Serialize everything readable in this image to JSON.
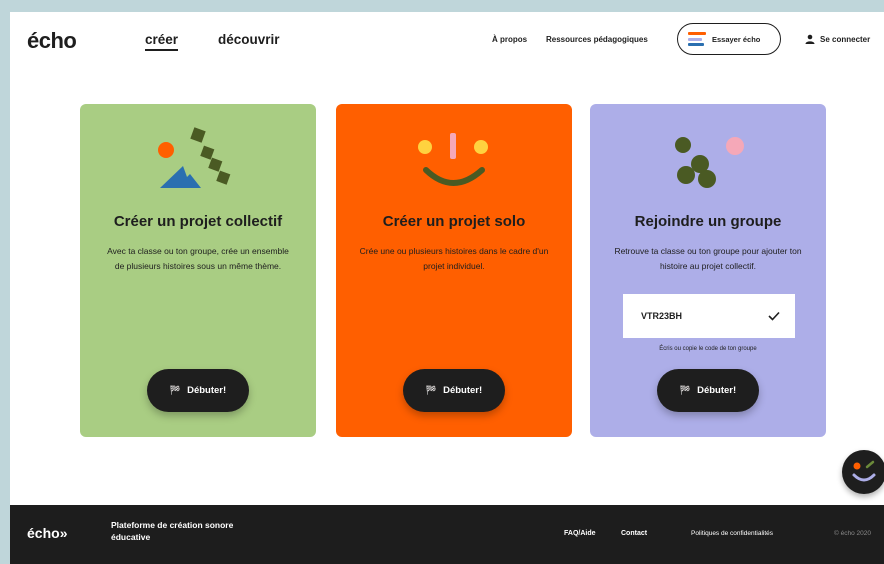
{
  "header": {
    "logo": "écho",
    "nav": {
      "creer": "créer",
      "decouvrir": "découvrir"
    },
    "links": {
      "apropos": "À propos",
      "ressources": "Ressources pédagogiques"
    },
    "try_button": "Essayer écho",
    "login": "Se connecter"
  },
  "cards": {
    "collective": {
      "title": "Créer un projet collectif",
      "description": "Avec ta classe ou ton groupe, crée un ensemble de plusieurs histoires sous un même thème.",
      "button": "Débuter!"
    },
    "solo": {
      "title": "Créer un projet solo",
      "description": "Crée une ou plusieurs histoires dans le cadre d'un projet individuel.",
      "button": "Débuter!"
    },
    "join": {
      "title": "Rejoindre un groupe",
      "description": "Retrouve ta classe ou ton groupe pour ajouter ton histoire au projet collectif.",
      "code_value": "VTR23BH",
      "code_hint": "Écris ou copie le code de ton groupe",
      "button": "Débuter!"
    }
  },
  "footer": {
    "logo": "écho",
    "tagline": "Plateforme de création sonore éducative",
    "faq": "FAQ/Aide",
    "contact": "Contact",
    "privacy": "Politiques de confidentialités",
    "copyright": "© écho 2020"
  },
  "colors": {
    "green": "#a9cd83",
    "orange": "#ff5f00",
    "lavender": "#adaee8",
    "dark": "#1e1e1e"
  }
}
